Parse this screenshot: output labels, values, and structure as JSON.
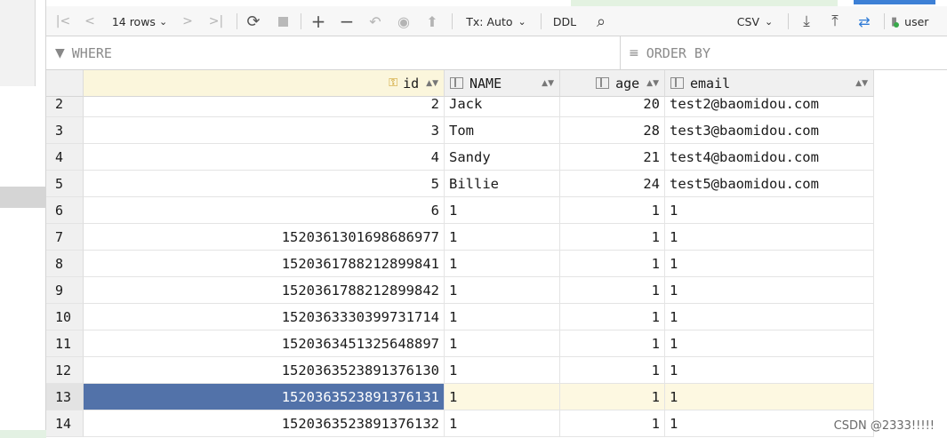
{
  "toolbar": {
    "rows_label": "14 rows",
    "tx_label": "Tx: Auto",
    "ddl_label": "DDL",
    "csv_label": "CSV",
    "user_label": "user",
    "icons": [
      "first-page-icon",
      "prev-page-icon",
      "next-page-icon",
      "last-page-icon",
      "reload-icon",
      "stop-icon",
      "add-row-icon",
      "delete-row-icon",
      "revert-icon",
      "preview-icon",
      "submit-icon",
      "search-icon",
      "download-icon",
      "upload-icon",
      "compare-icon",
      "datasource-icon"
    ],
    "chevron": "⌄"
  },
  "filter": {
    "where_placeholder": "WHERE",
    "order_placeholder": "ORDER BY"
  },
  "grid": {
    "columns": [
      {
        "name": "id"
      },
      {
        "name": "NAME"
      },
      {
        "name": "age"
      },
      {
        "name": "email"
      }
    ],
    "rows": [
      {
        "n": "2",
        "id": "2",
        "name": "Jack",
        "age": "20",
        "email": "test2@baomidou.com"
      },
      {
        "n": "3",
        "id": "3",
        "name": "Tom",
        "age": "28",
        "email": "test3@baomidou.com"
      },
      {
        "n": "4",
        "id": "4",
        "name": "Sandy",
        "age": "21",
        "email": "test4@baomidou.com"
      },
      {
        "n": "5",
        "id": "5",
        "name": "Billie",
        "age": "24",
        "email": "test5@baomidou.com"
      },
      {
        "n": "6",
        "id": "6",
        "name": "1",
        "age": "1",
        "email": "1"
      },
      {
        "n": "7",
        "id": "1520361301698686977",
        "name": "1",
        "age": "1",
        "email": "1"
      },
      {
        "n": "8",
        "id": "1520361788212899841",
        "name": "1",
        "age": "1",
        "email": "1"
      },
      {
        "n": "9",
        "id": "1520361788212899842",
        "name": "1",
        "age": "1",
        "email": "1"
      },
      {
        "n": "10",
        "id": "1520363330399731714",
        "name": "1",
        "age": "1",
        "email": "1"
      },
      {
        "n": "11",
        "id": "1520363451325648897",
        "name": "1",
        "age": "1",
        "email": "1"
      },
      {
        "n": "12",
        "id": "1520363523891376130",
        "name": "1",
        "age": "1",
        "email": "1"
      },
      {
        "n": "13",
        "id": "1520363523891376131",
        "name": "1",
        "age": "1",
        "email": "1"
      },
      {
        "n": "14",
        "id": "1520363523891376132",
        "name": "1",
        "age": "1",
        "email": "1"
      }
    ],
    "current_row": "13"
  },
  "watermark": "CSDN @2333!!!!!"
}
